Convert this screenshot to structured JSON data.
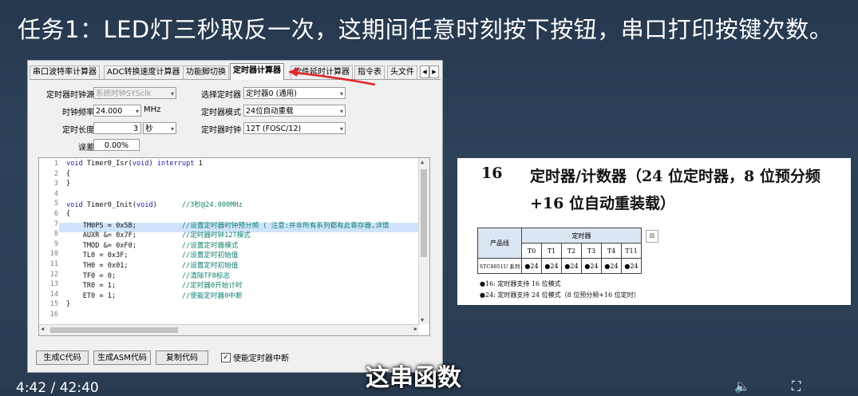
{
  "video_title": "任务1：LED灯三秒取反一次，这期间任意时刻按下按钮，串口打印按键次数。",
  "subtitle": "这串函数",
  "player": {
    "time": "4:42 / 42:40"
  },
  "tool": {
    "tabs": [
      "串口波特率计算器",
      "ADC转换速度计算器",
      "功能脚切换",
      "定时器计算器",
      "软件延时计算器",
      "指令表",
      "头文件"
    ],
    "active_tab_index": 3,
    "labels": {
      "clock_source": "定时器时钟源",
      "clock_freq": "时钟频率",
      "timer_length": "定时长度",
      "error": "误差",
      "select_timer": "选择定时器",
      "timer_mode": "定时器模式",
      "timer_clock": "定时器时钟"
    },
    "values": {
      "clock_source": "系统时钟SYSclk",
      "clock_freq": "24.000",
      "clock_freq_unit": "MHz",
      "timer_length": "3",
      "timer_length_unit": "秒",
      "error": "0.00%",
      "select_timer": "定时器0 (通用)",
      "timer_mode": "24位自动重载",
      "timer_clock": "12T (FOSC/12)"
    },
    "code": [
      {
        "n": "1",
        "t": "void Timer0_Isr(void) interrupt 1"
      },
      {
        "n": "2",
        "t": "{"
      },
      {
        "n": "3",
        "t": "}"
      },
      {
        "n": "4",
        "t": ""
      },
      {
        "n": "5",
        "t": "void Timer0_Init(void)      //3秒@24.000MHz"
      },
      {
        "n": "6",
        "t": "{"
      },
      {
        "n": "7",
        "t": "    TM0PS = 0x5B;           //设置定时器时钟预分频 ( 注意:并非所有系列都有此寄存器,详情"
      },
      {
        "n": "8",
        "t": "    AUXR &= 0x7F;           //定时器时钟12T模式"
      },
      {
        "n": "9",
        "t": "    TMOD &= 0xF0;           //设置定时器模式"
      },
      {
        "n": "10",
        "t": "    TL0 = 0x3F;             //设置定时初始值"
      },
      {
        "n": "11",
        "t": "    TH0 = 0x01;             //设置定时初始值"
      },
      {
        "n": "12",
        "t": "    TF0 = 0;                //清除TF0标志"
      },
      {
        "n": "13",
        "t": "    TR0 = 1;                //定时器0开始计时"
      },
      {
        "n": "14",
        "t": "    ET0 = 1;                //使能定时器0中断"
      },
      {
        "n": "15",
        "t": "}"
      },
      {
        "n": "16",
        "t": ""
      }
    ],
    "highlight_line": 7,
    "buttons": {
      "gen_c": "生成C代码",
      "gen_asm": "生成ASM代码",
      "copy": "复制代码"
    },
    "checkbox": {
      "label": "使能定时器中断",
      "checked": true
    }
  },
  "doc": {
    "section_num": "16",
    "heading_line1": "定时器/计数器（24 位定时器，8 位预分频",
    "heading_line2": "+16 位自动重装载）",
    "table": {
      "col_product": "产品线",
      "col_group": "定时器",
      "timers": [
        "T0",
        "T1",
        "T2",
        "T3",
        "T4",
        "T11"
      ],
      "row_label": "STC8051U 系列",
      "row_cells": [
        "●24",
        "●24",
        "●24",
        "●24",
        "●24",
        "●24"
      ]
    },
    "notes": [
      "●16: 定时器支持 16 位模式",
      "●24: 定时器支持 24 位模式（8 位预分频+16 位定时）"
    ]
  }
}
